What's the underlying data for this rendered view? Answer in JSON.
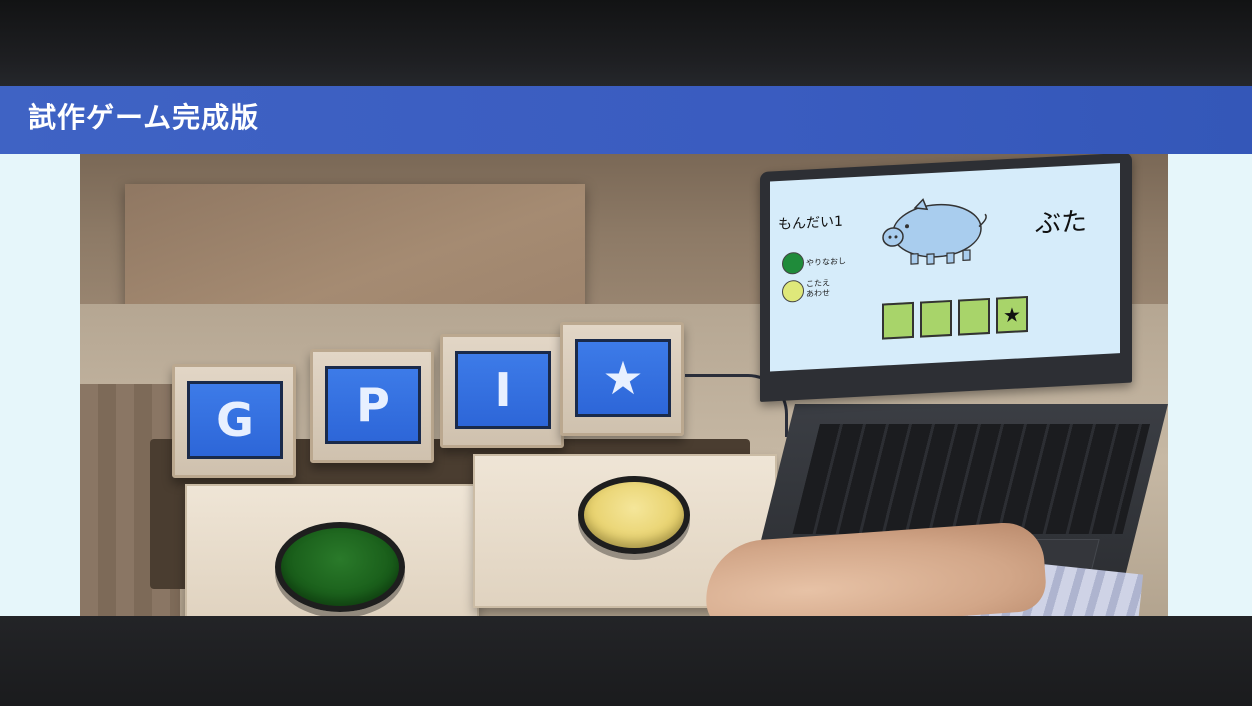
{
  "slide": {
    "title": "試作ゲーム完成版"
  },
  "game_boxes": [
    {
      "letter": "G"
    },
    {
      "letter": "P"
    },
    {
      "letter": "I"
    },
    {
      "letter": "★"
    }
  ],
  "laptop_game": {
    "question_label": "もんだい1",
    "answer_word": "ぶた",
    "option_retry": "やりなおし",
    "option_check_line1": "こたえ",
    "option_check_line2": "あわせ",
    "answer_slots": [
      "",
      "",
      "",
      "★"
    ]
  },
  "colors": {
    "title_bar": "#3f63c4",
    "slide_background": "#e6f6fa",
    "screen_blue": "#2f6cdc",
    "green_button": "#1f6a20",
    "yellow_button": "#e9d270",
    "slot_green": "#a8d46a"
  }
}
